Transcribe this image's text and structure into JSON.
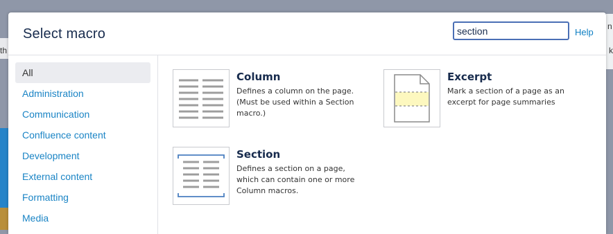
{
  "background": {
    "left_text": "th",
    "right_text": "n",
    "right_text2": "k"
  },
  "dialog": {
    "title": "Select macro",
    "search": {
      "value": "section",
      "placeholder": ""
    },
    "help_label": "Help"
  },
  "sidebar": {
    "items": [
      {
        "label": "All",
        "active": true
      },
      {
        "label": "Administration"
      },
      {
        "label": "Communication"
      },
      {
        "label": "Confluence content"
      },
      {
        "label": "Development"
      },
      {
        "label": "External content"
      },
      {
        "label": "Formatting"
      },
      {
        "label": "Media"
      }
    ]
  },
  "macros": [
    {
      "name": "Column",
      "description": "Defines a column on the page. (Must be used within a Section macro.)",
      "icon": "column-icon"
    },
    {
      "name": "Excerpt",
      "description": "Mark a section of a page as an excerpt for page summaries",
      "icon": "excerpt-icon"
    },
    {
      "name": "Section",
      "description": "Defines a section on a page, which can contain one or more Column macros.",
      "icon": "section-icon"
    }
  ],
  "colors": {
    "link": "#1a84c5",
    "title": "#172b4d",
    "search_border": "#4a6fb5",
    "excerpt_highlight": "#fdf8bf"
  }
}
